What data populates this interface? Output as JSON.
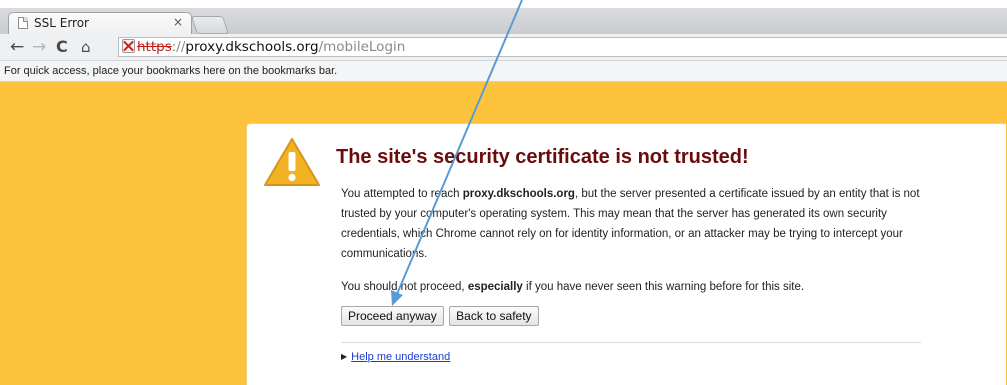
{
  "window": {
    "tab_title": "SSL Error",
    "tab_close": "×"
  },
  "toolbar": {
    "back": "←",
    "forward": "→",
    "reload": "C",
    "home": "⌂",
    "url_scheme": "https",
    "url_separator": "://",
    "url_host": "proxy.dkschools.org",
    "url_path": "/mobileLogin"
  },
  "bookmarks_bar": {
    "message": "For quick access, place your bookmarks here on the bookmarks bar."
  },
  "interstitial": {
    "title": "The site's security certificate is not trusted!",
    "para1_before": "You attempted to reach ",
    "para1_host": "proxy.dkschools.org",
    "para1_after": ", but the server presented a certificate issued by an entity that is not trusted by your computer's operating system. This may mean that the server has generated its own security credentials, which Chrome cannot rely on for identity information, or an attacker may be trying to intercept your communications.",
    "para2_before": "You should not proceed, ",
    "para2_emphasis": "especially",
    "para2_after": " if you have never seen this warning before for this site.",
    "proceed_button": "Proceed anyway",
    "back_button": "Back to safety",
    "help_arrow": "▶",
    "help_link": "Help me understand"
  },
  "colors": {
    "page_background": "#fec33c",
    "title_color": "#6a0c0c",
    "annotation_arrow": "#5b9bd5",
    "link_color": "#1a3bd1"
  },
  "icons": {
    "warning": "warning-triangle-icon",
    "tab_favicon": "page-icon",
    "security": "broken-lock-icon"
  }
}
